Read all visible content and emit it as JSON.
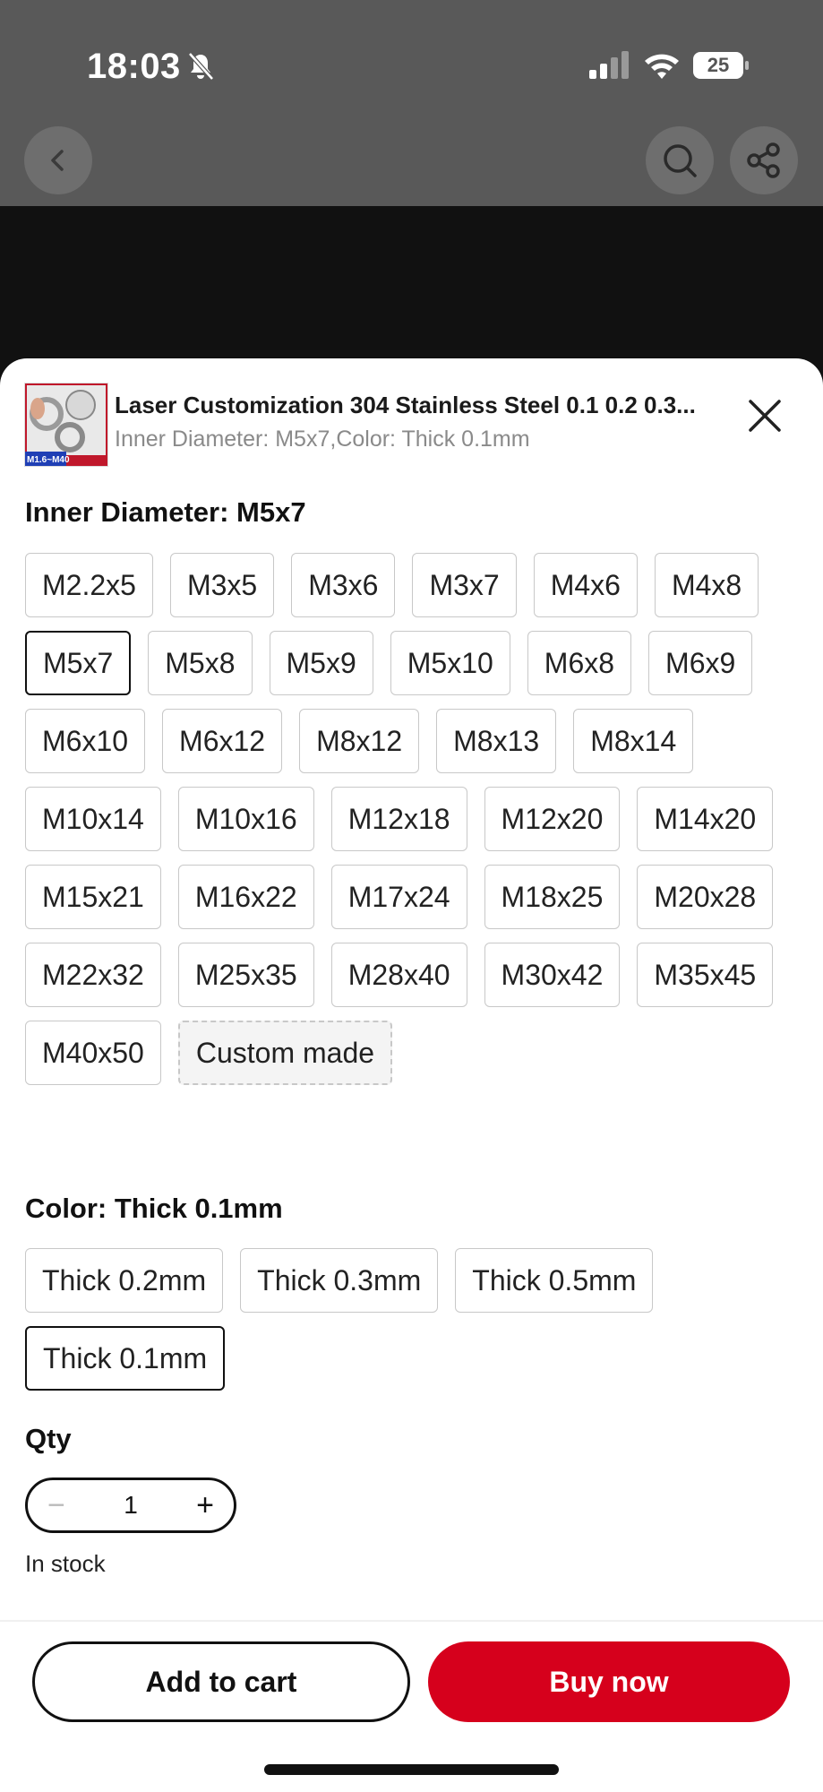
{
  "status_bar": {
    "time": "18:03",
    "battery": "25"
  },
  "product": {
    "title": "Laser Customization 304 Stainless Steel 0.1 0.2 0.3...",
    "selection_summary": "Inner Diameter: M5x7,Color: Thick 0.1mm",
    "thumbnail_text": "M1.6~M40"
  },
  "inner_diameter": {
    "label": "Inner Diameter: M5x7",
    "selected": "M5x7",
    "options": [
      "M2.2x5",
      "M3x5",
      "M3x6",
      "M3x7",
      "M4x6",
      "M4x8",
      "M5x7",
      "M5x8",
      "M5x9",
      "M5x10",
      "M6x8",
      "M6x9",
      "M6x10",
      "M6x12",
      "M8x12",
      "M8x13",
      "M8x14",
      "M10x14",
      "M10x16",
      "M12x18",
      "M12x20",
      "M14x20",
      "M15x21",
      "M16x22",
      "M17x24",
      "M18x25",
      "M20x28",
      "M22x32",
      "M25x35",
      "M28x40",
      "M30x42",
      "M35x45",
      "M40x50"
    ],
    "custom_label": "Custom made"
  },
  "color": {
    "label": "Color: Thick 0.1mm",
    "selected": "Thick 0.1mm",
    "options": [
      "Thick 0.2mm",
      "Thick 0.3mm",
      "Thick 0.5mm",
      "Thick 0.1mm"
    ]
  },
  "qty": {
    "label": "Qty",
    "value": "1",
    "minus": "−",
    "plus": "+"
  },
  "stock_status": "In stock",
  "actions": {
    "add_to_cart": "Add to cart",
    "buy_now": "Buy now"
  },
  "icons": {
    "back": "chevron-left-icon",
    "search": "search-icon",
    "share": "share-icon",
    "close": "close-icon"
  },
  "colors": {
    "accent": "#d6001c"
  }
}
